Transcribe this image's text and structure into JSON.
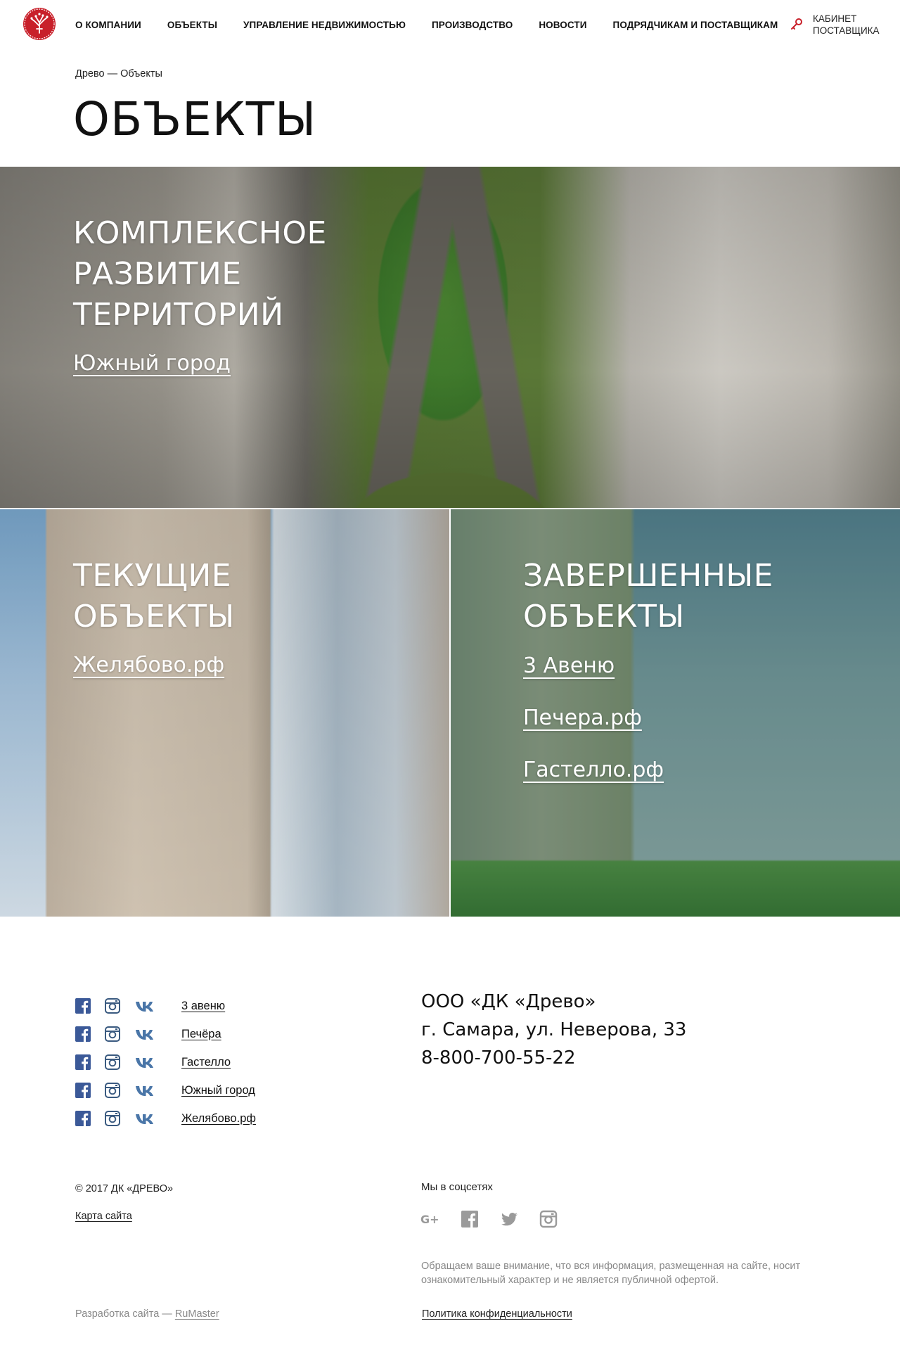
{
  "colors": {
    "brand_red": "#c8202a",
    "facebook": "#3b5998",
    "vk": "#4a76a8",
    "social_gray": "#9a9a9a"
  },
  "header": {
    "logo_icon": "tree-logo-icon",
    "nav": [
      "О КОМПАНИИ",
      "ОБЪЕКТЫ",
      "УПРАВЛЕНИЕ НЕДВИЖИМОСТЬЮ",
      "ПРОИЗВОДСТВО",
      "НОВОСТИ",
      "ПОДРЯДЧИКАМ И ПОСТАВЩИКАМ"
    ],
    "cabinet_icon": "key-icon",
    "cabinet_label": "КАБИНЕТ ПОСТАВЩИКА"
  },
  "breadcrumb": "Древо — Объекты",
  "page_title": "ОБЪЕКТЫ",
  "blocks": {
    "territory": {
      "heading": "КОМПЛЕКСНОЕ РАЗВИТИЕ ТЕРРИТОРИЙ",
      "links": [
        "Южный город"
      ]
    },
    "current": {
      "heading": "ТЕКУЩИЕ ОБЪЕКТЫ",
      "links": [
        "Желябово.рф"
      ]
    },
    "done": {
      "heading": "ЗАВЕРШЕННЫЕ ОБЪЕКТЫ",
      "links": [
        "3 Авеню",
        "Печера.рф",
        "Гастелло.рф"
      ]
    }
  },
  "footer": {
    "projects": [
      "3 авеню",
      "Печёра",
      "Гастелло",
      "Южный город",
      "Желябово.рф"
    ],
    "company": {
      "name": "ООО «ДК «Древо»",
      "address": "г. Самара, ул. Неверова, 33",
      "phone": "8-800-700-55-22"
    },
    "copyright": "© 2017 ДК «ДРЕВО»",
    "sitemap": "Карта сайта",
    "social_title": "Мы в соцсетях",
    "social_icons": [
      "google-plus-icon",
      "facebook-icon",
      "twitter-icon",
      "instagram-icon"
    ],
    "notice": "Обращаем ваше внимание, что вся информация, размещенная на сайте, носит ознакомительный характер и не является публичной офертой.",
    "dev_prefix": "Разработка сайта — ",
    "dev_link": "RuMaster",
    "privacy": "Политика конфиденциальности"
  }
}
